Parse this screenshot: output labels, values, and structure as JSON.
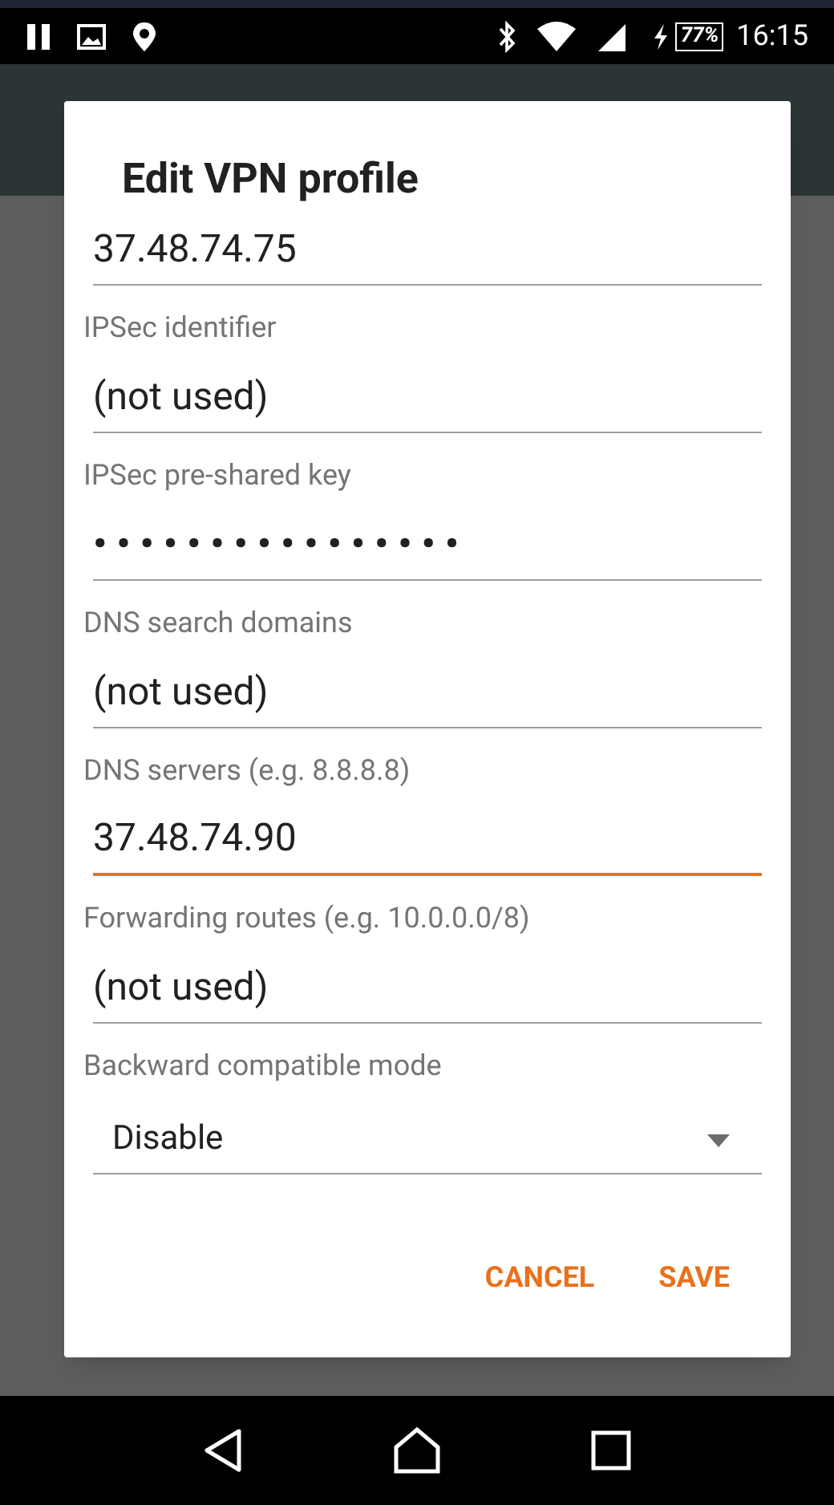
{
  "status_bar": {
    "battery": "77%",
    "time": "16:15"
  },
  "dialog": {
    "title": "Edit VPN profile",
    "fields": [
      {
        "kind": "text",
        "value": "37.48.74.75",
        "focused": false
      },
      {
        "kind": "text",
        "label": "IPSec identifier",
        "value": "(not used)",
        "focused": false
      },
      {
        "kind": "password",
        "label": "IPSec pre-shared key",
        "value": "••••••••••••••••",
        "focused": false
      },
      {
        "kind": "text",
        "label": "DNS search domains",
        "value": "(not used)",
        "focused": false
      },
      {
        "kind": "text",
        "label": "DNS servers (e.g. 8.8.8.8)",
        "value": "37.48.74.90",
        "focused": true
      },
      {
        "kind": "text",
        "label": "Forwarding routes (e.g. 10.0.0.0/8)",
        "value": "(not used)",
        "focused": false
      },
      {
        "kind": "dropdown",
        "label": "Backward compatible mode",
        "value": "Disable",
        "focused": false
      }
    ],
    "buttons": [
      "CANCEL",
      "SAVE"
    ]
  }
}
